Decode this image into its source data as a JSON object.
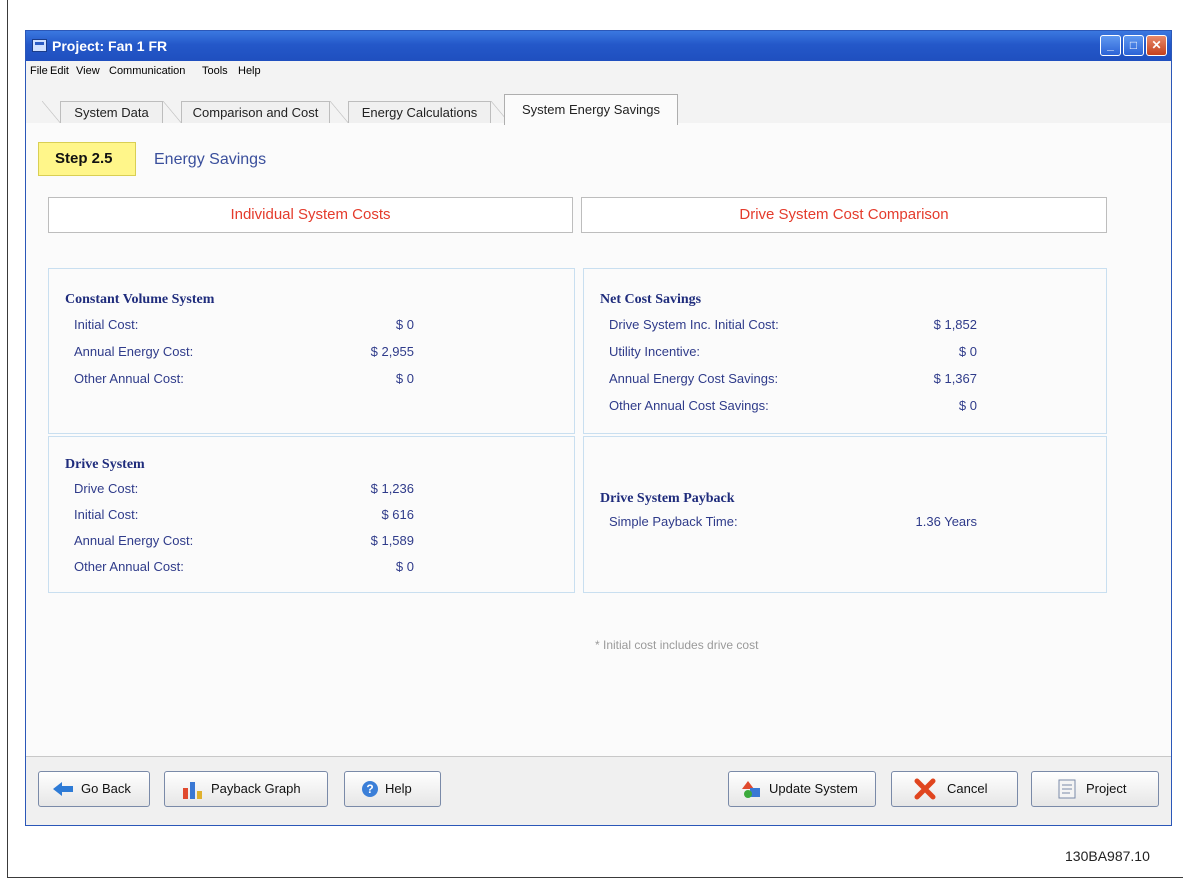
{
  "window": {
    "title": "Project: Fan 1 FR"
  },
  "menu": [
    "File",
    "Edit",
    "View",
    "Communication",
    "Tools",
    "Help"
  ],
  "tabs": [
    {
      "label": "System Data",
      "active": false
    },
    {
      "label": "Comparison and Cost",
      "active": false
    },
    {
      "label": "Energy Calculations",
      "active": false
    },
    {
      "label": "System Energy Savings",
      "active": true
    }
  ],
  "step": {
    "badge": "Step 2.5",
    "title": "Energy Savings"
  },
  "headers": {
    "left": "Individual System Costs",
    "right": "Drive System Cost Comparison"
  },
  "constant_volume": {
    "title": "Constant Volume System",
    "rows": [
      {
        "label": "Initial Cost:",
        "value": "$ 0"
      },
      {
        "label": "Annual Energy Cost:",
        "value": "$ 2,955"
      },
      {
        "label": "Other Annual Cost:",
        "value": "$ 0"
      }
    ]
  },
  "drive_system": {
    "title": "Drive System",
    "rows": [
      {
        "label": "Drive Cost:",
        "value": "$ 1,236"
      },
      {
        "label": "Initial Cost:",
        "value": "$ 616"
      },
      {
        "label": "Annual Energy Cost:",
        "value": "$ 1,589"
      },
      {
        "label": "Other Annual Cost:",
        "value": "$ 0"
      }
    ]
  },
  "net_savings": {
    "title": "Net Cost Savings",
    "rows": [
      {
        "label": "Drive System Inc. Initial Cost:",
        "value": "$ 1,852"
      },
      {
        "label": "Utility Incentive:",
        "value": "$ 0"
      },
      {
        "label": "Annual Energy Cost Savings:",
        "value": "$ 1,367"
      },
      {
        "label": "Other Annual Cost Savings:",
        "value": "$ 0"
      }
    ]
  },
  "payback": {
    "title": "Drive System Payback",
    "label": "Simple Payback Time:",
    "value": "1.36 Years"
  },
  "note": "* Initial cost includes drive cost",
  "buttons": {
    "go_back": "Go Back",
    "payback_graph": "Payback Graph",
    "help": "Help",
    "update_system": "Update System",
    "cancel": "Cancel",
    "project": "Project"
  },
  "figure_code": "130BA987.10",
  "colors": {
    "titlebar": "#2458c9",
    "header_text": "#e43b2c",
    "label_text": "#2f3b8a",
    "step_badge": "#fff68a"
  }
}
